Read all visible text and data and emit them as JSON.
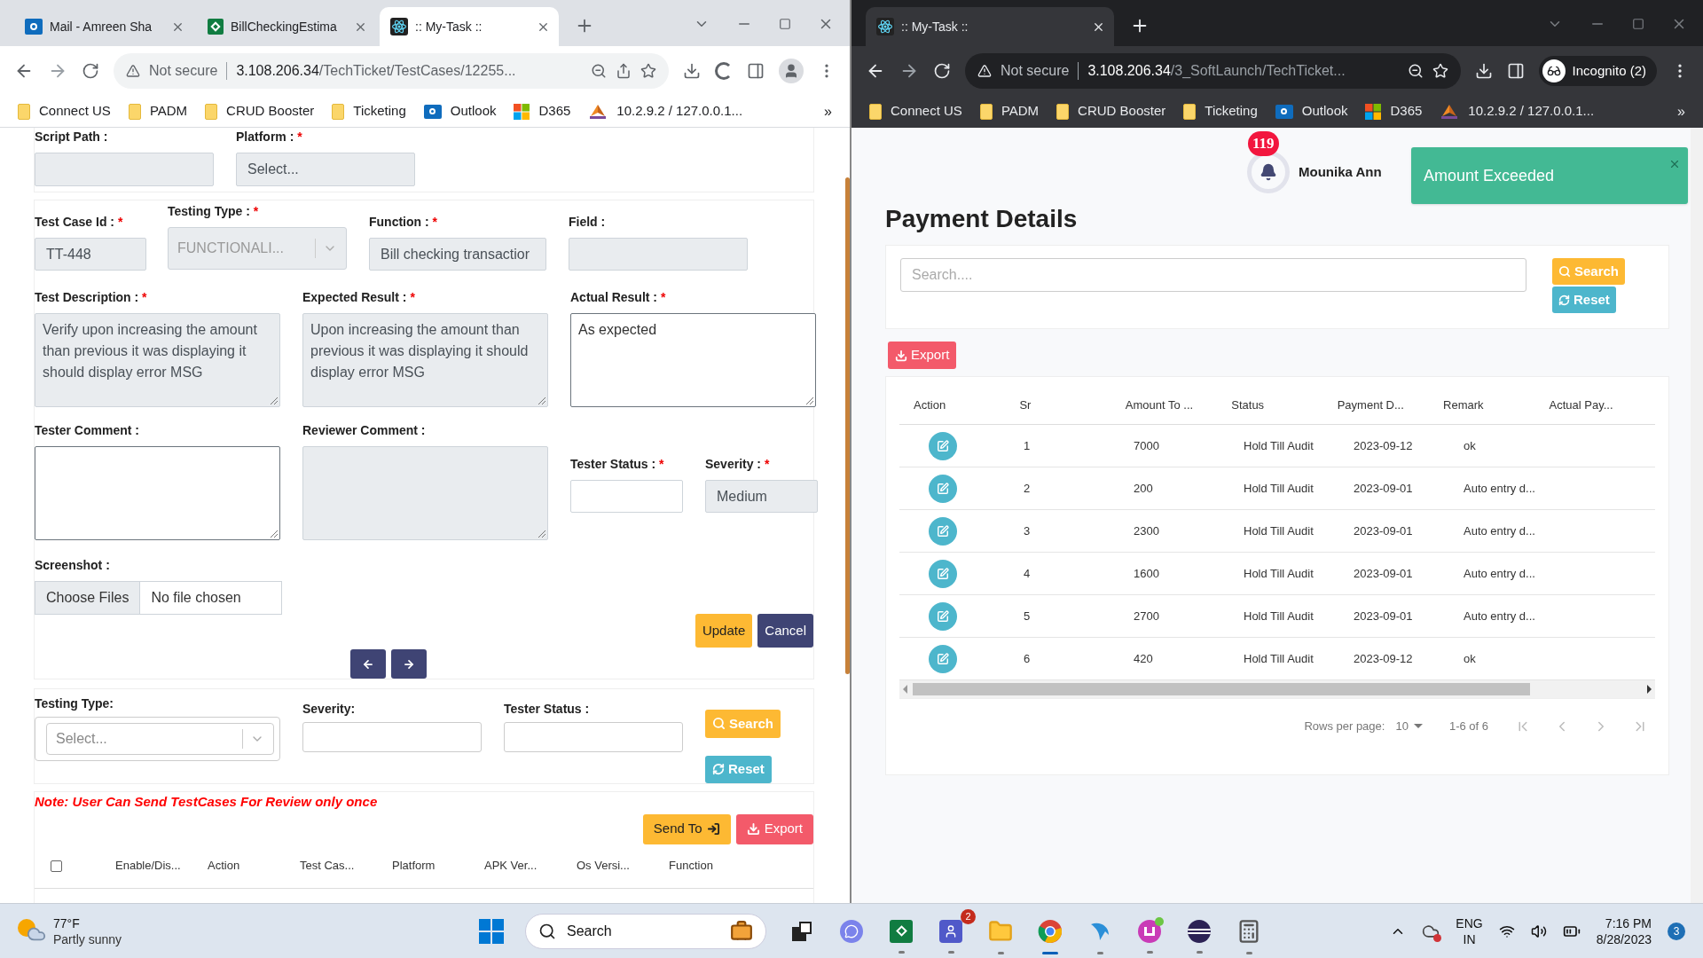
{
  "left_window": {
    "incognito": false,
    "tabs": [
      {
        "title": "Mail - Amreen Sha",
        "kind": "mail",
        "selected": false
      },
      {
        "title": "BillCheckingEstima",
        "kind": "sheet",
        "selected": false
      },
      {
        "title": ":: My-Task ::",
        "kind": "app",
        "selected": true
      }
    ],
    "address": {
      "security": "Not secure",
      "host": "3.108.206.34",
      "path": "/TechTicket/TestCases/12255..."
    },
    "profile": {
      "kind": "avatar"
    },
    "bookmarks": [
      {
        "label": "Connect US",
        "kind": "folder"
      },
      {
        "label": "PADM",
        "kind": "folder"
      },
      {
        "label": "CRUD Booster",
        "kind": "folder"
      },
      {
        "label": "Ticketing",
        "kind": "folder"
      },
      {
        "label": "Outlook",
        "kind": "mail"
      },
      {
        "label": "D365",
        "kind": "grid"
      },
      {
        "label": "10.2.9.2 / 127.0.0.1...",
        "kind": "logo"
      }
    ],
    "bookmarks_more": "»",
    "page": {
      "top_fields": [
        {
          "label": "Script Path :",
          "kind": "input",
          "disabled": true
        },
        {
          "label": "Platform :",
          "required_mark": "*",
          "kind": "input",
          "value": "Select...",
          "disabled": true
        }
      ],
      "row1": [
        {
          "label": "Test Case Id :",
          "required_mark": "*",
          "kind": "input",
          "value": "TT-448",
          "disabled": true
        },
        {
          "label": "Testing Type :",
          "required_mark": "*",
          "kind": "select",
          "placeholder": "FUNCTIONALI...",
          "disabled": true
        },
        {
          "label": "Function :",
          "required_mark": "*",
          "kind": "input",
          "value": "Bill checking transactior",
          "disabled": true
        },
        {
          "label": "Field :",
          "kind": "input",
          "disabled": true
        }
      ],
      "row2": [
        {
          "label": "Test Description :",
          "required_mark": "*",
          "kind": "textarea",
          "value": "Verify upon increasing the amount than previous it was displaying it should display error MSG",
          "disabled": true
        },
        {
          "label": "Expected Result :",
          "required_mark": "*",
          "kind": "textarea",
          "value": "Upon increasing the amount than previous it was displaying it should display error MSG",
          "disabled": true
        },
        {
          "label": "Actual Result :",
          "required_mark": "*",
          "kind": "textarea",
          "value": "As expected",
          "disabled": false
        }
      ],
      "row3": [
        {
          "label": "Tester Comment :",
          "kind": "textarea",
          "disabled": false
        },
        {
          "label": "Reviewer Comment :",
          "kind": "textarea",
          "disabled": true
        }
      ],
      "row3_side": [
        {
          "label": "Tester Status :",
          "required_mark": "*",
          "kind": "input",
          "disabled": false
        },
        {
          "label": "Severity :",
          "required_mark": "*",
          "kind": "input",
          "value": "Medium",
          "disabled": true
        }
      ],
      "screenshot": {
        "label": "Screenshot :",
        "button": "Choose Files",
        "status": "No file chosen"
      },
      "form_buttons": [
        {
          "label": "Update",
          "kind": "warning"
        },
        {
          "label": "Cancel",
          "kind": "primary"
        }
      ],
      "filter": {
        "fields": [
          {
            "label": "Testing Type:",
            "kind": "select",
            "placeholder": "Select..."
          },
          {
            "label": "Severity:",
            "kind": "input"
          },
          {
            "label": "Tester Status :",
            "kind": "input"
          }
        ],
        "search": "Search",
        "reset": "Reset"
      },
      "note": "Note: User Can Send TestCases For Review only once",
      "table_buttons": [
        {
          "label": "Send To",
          "kind": "warning"
        },
        {
          "label": "Export",
          "kind": "danger"
        }
      ],
      "table": {
        "select_all": {
          "checked": false
        },
        "columns": [
          "Enable/Dis...",
          "Action",
          "Test Cas...",
          "Platform",
          "APK Ver...",
          "Os Versi...",
          "Function"
        ]
      }
    }
  },
  "right_window": {
    "incognito": true,
    "tabs": [
      {
        "title": ":: My-Task ::",
        "kind": "app",
        "selected": true
      }
    ],
    "address": {
      "security": "Not secure",
      "host": "3.108.206.34",
      "path": "/3_SoftLaunch/TechTicket..."
    },
    "profile": {
      "kind": "incognito",
      "label": "Incognito (2)"
    },
    "bookmarks": [
      {
        "label": "Connect US",
        "kind": "folder"
      },
      {
        "label": "PADM",
        "kind": "folder"
      },
      {
        "label": "CRUD Booster",
        "kind": "folder"
      },
      {
        "label": "Ticketing",
        "kind": "folder"
      },
      {
        "label": "Outlook",
        "kind": "mail"
      },
      {
        "label": "D365",
        "kind": "grid"
      },
      {
        "label": "10.2.9.2 / 127.0.0.1...",
        "kind": "logo"
      }
    ],
    "bookmarks_more": "»",
    "page": {
      "notifications": "119",
      "user": "Mounika Ann",
      "toast": "Amount Exceeded",
      "title": "Payment Details",
      "search": {
        "placeholder": "Search....",
        "button": "Search",
        "reset": "Reset"
      },
      "export": "Export",
      "table": {
        "columns": [
          "Action",
          "Sr",
          "Amount To ...",
          "Status",
          "Payment D...",
          "Remark",
          "Actual Pay..."
        ],
        "rows": [
          [
            "",
            "1",
            "7000",
            "Hold Till Audit",
            "2023-09-12",
            "ok"
          ],
          [
            "",
            "2",
            "200",
            "Hold Till Audit",
            "2023-09-01",
            "Auto entry d..."
          ],
          [
            "",
            "3",
            "2300",
            "Hold Till Audit",
            "2023-09-01",
            "Auto entry d..."
          ],
          [
            "",
            "4",
            "1600",
            "Hold Till Audit",
            "2023-09-01",
            "Auto entry d..."
          ],
          [
            "",
            "5",
            "2700",
            "Hold Till Audit",
            "2023-09-01",
            "Auto entry d..."
          ],
          [
            "",
            "6",
            "420",
            "Hold Till Audit",
            "2023-09-12",
            "ok"
          ]
        ]
      },
      "pagination": {
        "rows_label": "Rows per page:",
        "rows_value": "10",
        "range": "1-6 of 6"
      }
    }
  },
  "taskbar": {
    "weather": {
      "temp": "77°F",
      "text": "Partly sunny"
    },
    "search": "Search",
    "apps": [
      {
        "kind": "taskview",
        "running": false,
        "selected": false
      },
      {
        "kind": "chat",
        "running": false,
        "selected": false
      },
      {
        "kind": "excel",
        "running": true,
        "selected": false
      },
      {
        "kind": "teams",
        "running": true,
        "selected": false,
        "badge": "2"
      },
      {
        "kind": "files",
        "running": true,
        "selected": false
      },
      {
        "kind": "chrome",
        "running": true,
        "selected": true
      },
      {
        "kind": "dolphin",
        "running": true,
        "selected": false
      },
      {
        "kind": "wps",
        "running": true,
        "selected": false
      },
      {
        "kind": "eclipse",
        "running": true,
        "selected": false
      },
      {
        "kind": "calculator",
        "running": true,
        "selected": false
      }
    ],
    "language": [
      "ENG",
      "IN"
    ],
    "time": "7:16 PM",
    "date": "8/28/2023",
    "notifications": "3"
  }
}
